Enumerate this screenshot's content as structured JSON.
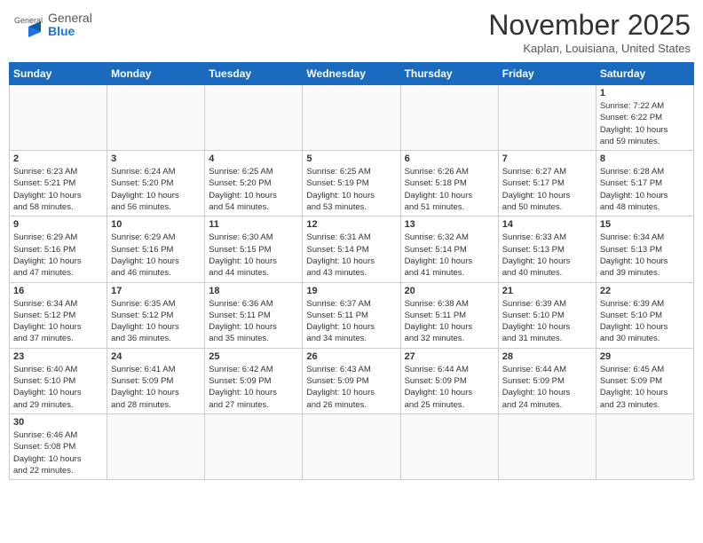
{
  "header": {
    "logo_general": "General",
    "logo_blue": "Blue",
    "month_title": "November 2025",
    "location": "Kaplan, Louisiana, United States"
  },
  "weekdays": [
    "Sunday",
    "Monday",
    "Tuesday",
    "Wednesday",
    "Thursday",
    "Friday",
    "Saturday"
  ],
  "weeks": [
    [
      {
        "day": "",
        "info": ""
      },
      {
        "day": "",
        "info": ""
      },
      {
        "day": "",
        "info": ""
      },
      {
        "day": "",
        "info": ""
      },
      {
        "day": "",
        "info": ""
      },
      {
        "day": "",
        "info": ""
      },
      {
        "day": "1",
        "info": "Sunrise: 7:22 AM\nSunset: 6:22 PM\nDaylight: 10 hours\nand 59 minutes."
      }
    ],
    [
      {
        "day": "2",
        "info": "Sunrise: 6:23 AM\nSunset: 5:21 PM\nDaylight: 10 hours\nand 58 minutes."
      },
      {
        "day": "3",
        "info": "Sunrise: 6:24 AM\nSunset: 5:20 PM\nDaylight: 10 hours\nand 56 minutes."
      },
      {
        "day": "4",
        "info": "Sunrise: 6:25 AM\nSunset: 5:20 PM\nDaylight: 10 hours\nand 54 minutes."
      },
      {
        "day": "5",
        "info": "Sunrise: 6:25 AM\nSunset: 5:19 PM\nDaylight: 10 hours\nand 53 minutes."
      },
      {
        "day": "6",
        "info": "Sunrise: 6:26 AM\nSunset: 5:18 PM\nDaylight: 10 hours\nand 51 minutes."
      },
      {
        "day": "7",
        "info": "Sunrise: 6:27 AM\nSunset: 5:17 PM\nDaylight: 10 hours\nand 50 minutes."
      },
      {
        "day": "8",
        "info": "Sunrise: 6:28 AM\nSunset: 5:17 PM\nDaylight: 10 hours\nand 48 minutes."
      }
    ],
    [
      {
        "day": "9",
        "info": "Sunrise: 6:29 AM\nSunset: 5:16 PM\nDaylight: 10 hours\nand 47 minutes."
      },
      {
        "day": "10",
        "info": "Sunrise: 6:29 AM\nSunset: 5:16 PM\nDaylight: 10 hours\nand 46 minutes."
      },
      {
        "day": "11",
        "info": "Sunrise: 6:30 AM\nSunset: 5:15 PM\nDaylight: 10 hours\nand 44 minutes."
      },
      {
        "day": "12",
        "info": "Sunrise: 6:31 AM\nSunset: 5:14 PM\nDaylight: 10 hours\nand 43 minutes."
      },
      {
        "day": "13",
        "info": "Sunrise: 6:32 AM\nSunset: 5:14 PM\nDaylight: 10 hours\nand 41 minutes."
      },
      {
        "day": "14",
        "info": "Sunrise: 6:33 AM\nSunset: 5:13 PM\nDaylight: 10 hours\nand 40 minutes."
      },
      {
        "day": "15",
        "info": "Sunrise: 6:34 AM\nSunset: 5:13 PM\nDaylight: 10 hours\nand 39 minutes."
      }
    ],
    [
      {
        "day": "16",
        "info": "Sunrise: 6:34 AM\nSunset: 5:12 PM\nDaylight: 10 hours\nand 37 minutes."
      },
      {
        "day": "17",
        "info": "Sunrise: 6:35 AM\nSunset: 5:12 PM\nDaylight: 10 hours\nand 36 minutes."
      },
      {
        "day": "18",
        "info": "Sunrise: 6:36 AM\nSunset: 5:11 PM\nDaylight: 10 hours\nand 35 minutes."
      },
      {
        "day": "19",
        "info": "Sunrise: 6:37 AM\nSunset: 5:11 PM\nDaylight: 10 hours\nand 34 minutes."
      },
      {
        "day": "20",
        "info": "Sunrise: 6:38 AM\nSunset: 5:11 PM\nDaylight: 10 hours\nand 32 minutes."
      },
      {
        "day": "21",
        "info": "Sunrise: 6:39 AM\nSunset: 5:10 PM\nDaylight: 10 hours\nand 31 minutes."
      },
      {
        "day": "22",
        "info": "Sunrise: 6:39 AM\nSunset: 5:10 PM\nDaylight: 10 hours\nand 30 minutes."
      }
    ],
    [
      {
        "day": "23",
        "info": "Sunrise: 6:40 AM\nSunset: 5:10 PM\nDaylight: 10 hours\nand 29 minutes."
      },
      {
        "day": "24",
        "info": "Sunrise: 6:41 AM\nSunset: 5:09 PM\nDaylight: 10 hours\nand 28 minutes."
      },
      {
        "day": "25",
        "info": "Sunrise: 6:42 AM\nSunset: 5:09 PM\nDaylight: 10 hours\nand 27 minutes."
      },
      {
        "day": "26",
        "info": "Sunrise: 6:43 AM\nSunset: 5:09 PM\nDaylight: 10 hours\nand 26 minutes."
      },
      {
        "day": "27",
        "info": "Sunrise: 6:44 AM\nSunset: 5:09 PM\nDaylight: 10 hours\nand 25 minutes."
      },
      {
        "day": "28",
        "info": "Sunrise: 6:44 AM\nSunset: 5:09 PM\nDaylight: 10 hours\nand 24 minutes."
      },
      {
        "day": "29",
        "info": "Sunrise: 6:45 AM\nSunset: 5:09 PM\nDaylight: 10 hours\nand 23 minutes."
      }
    ],
    [
      {
        "day": "30",
        "info": "Sunrise: 6:46 AM\nSunset: 5:08 PM\nDaylight: 10 hours\nand 22 minutes."
      },
      {
        "day": "",
        "info": ""
      },
      {
        "day": "",
        "info": ""
      },
      {
        "day": "",
        "info": ""
      },
      {
        "day": "",
        "info": ""
      },
      {
        "day": "",
        "info": ""
      },
      {
        "day": "",
        "info": ""
      }
    ]
  ]
}
